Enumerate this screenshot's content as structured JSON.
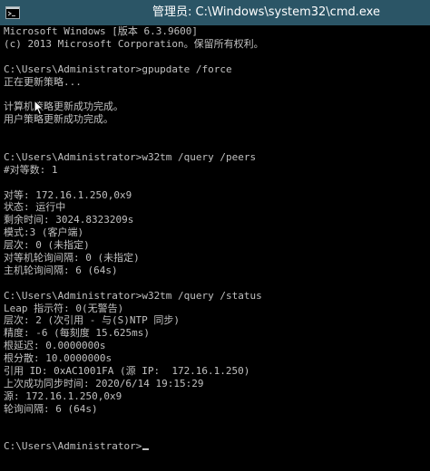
{
  "window": {
    "title": "管理员: C:\\Windows\\system32\\cmd.exe"
  },
  "console": {
    "lines": [
      "Microsoft Windows [版本 6.3.9600]",
      "(c) 2013 Microsoft Corporation。保留所有权利。",
      "",
      "C:\\Users\\Administrator>gpupdate /force",
      "正在更新策略...",
      "",
      "计算机策略更新成功完成。",
      "用户策略更新成功完成。",
      "",
      "",
      "C:\\Users\\Administrator>w32tm /query /peers",
      "#对等数: 1",
      "",
      "对等: 172.16.1.250,0x9",
      "状态: 运行中",
      "剩余时间: 3024.8323209s",
      "模式:3 (客户端)",
      "层次: 0 (未指定)",
      "对等机轮询间隔: 0 (未指定)",
      "主机轮询间隔: 6 (64s)",
      "",
      "C:\\Users\\Administrator>w32tm /query /status",
      "Leap 指示符: 0(无警告)",
      "层次: 2 (次引用 - 与(S)NTP 同步)",
      "精度: -6 (每刻度 15.625ms)",
      "根延迟: 0.0000000s",
      "根分散: 10.0000000s",
      "引用 ID: 0xAC1001FA (源 IP:  172.16.1.250)",
      "上次成功同步时间: 2020/6/14 19:15:29",
      "源: 172.16.1.250,0x9",
      "轮询间隔: 6 (64s)",
      "",
      "",
      "C:\\Users\\Administrator>"
    ]
  }
}
